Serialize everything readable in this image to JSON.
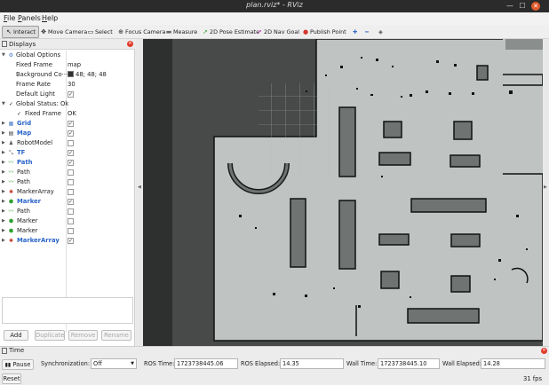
{
  "window": {
    "title": "plan.rviz* - RViz"
  },
  "menu": [
    {
      "label": "File",
      "mnemonic": "F",
      "rest": "ile"
    },
    {
      "label": "Panels",
      "mnemonic": "P",
      "rest": "anels"
    },
    {
      "label": "Help",
      "mnemonic": "H",
      "rest": "elp"
    }
  ],
  "toolbar": {
    "interact": "Interact",
    "move_camera": "Move Camera",
    "select": "Select",
    "focus_camera": "Focus Camera",
    "measure": "Measure",
    "pose_estimate": "2D Pose Estimate",
    "nav_goal": "2D Nav Goal",
    "publish_point": "Publish Point"
  },
  "displays": {
    "header": "Displays",
    "global_options": "Global Options",
    "fixed_frame_label": "Fixed Frame",
    "fixed_frame_value": "map",
    "background_label": "Background Co···",
    "background_value": "48; 48; 48",
    "background_color": "#303030",
    "frame_rate_label": "Frame Rate",
    "frame_rate_value": "30",
    "default_light_label": "Default Light",
    "global_status": "Global Status: Ok",
    "status_fixed_frame": "Fixed Frame",
    "status_fixed_frame_value": "OK",
    "items": [
      {
        "name": "Grid",
        "checked": true,
        "highlight": true,
        "icon": "grid-icon"
      },
      {
        "name": "Map",
        "checked": true,
        "highlight": true,
        "icon": "map-icon"
      },
      {
        "name": "RobotModel",
        "checked": false,
        "highlight": false,
        "icon": "robot-icon"
      },
      {
        "name": "TF",
        "checked": true,
        "highlight": true,
        "icon": "tf-icon"
      },
      {
        "name": "Path",
        "checked": true,
        "highlight": true,
        "icon": "path-icon"
      },
      {
        "name": "Path",
        "checked": false,
        "highlight": false,
        "icon": "path-icon"
      },
      {
        "name": "Path",
        "checked": false,
        "highlight": false,
        "icon": "path-icon"
      },
      {
        "name": "MarkerArray",
        "checked": false,
        "highlight": false,
        "icon": "marker-array-icon"
      },
      {
        "name": "Marker",
        "checked": true,
        "highlight": true,
        "icon": "marker-icon"
      },
      {
        "name": "Path",
        "checked": false,
        "highlight": false,
        "icon": "path-icon"
      },
      {
        "name": "Marker",
        "checked": false,
        "highlight": false,
        "icon": "marker-icon"
      },
      {
        "name": "Marker",
        "checked": false,
        "highlight": false,
        "icon": "marker-icon"
      },
      {
        "name": "MarkerArray",
        "checked": true,
        "highlight": true,
        "icon": "marker-array-icon"
      }
    ],
    "buttons": {
      "add": "Add",
      "duplicate": "Duplicate",
      "remove": "Remove",
      "rename": "Rename"
    }
  },
  "time": {
    "header": "Time",
    "pause": "Pause",
    "sync_label": "Synchronization:",
    "sync_value": "Off",
    "ros_time_label": "ROS Time:",
    "ros_time": "1723738445.06",
    "ros_elapsed_label": "ROS Elapsed:",
    "ros_elapsed": "14.35",
    "wall_time_label": "Wall Time:",
    "wall_time": "1723738445.10",
    "wall_elapsed_label": "Wall Elapsed:",
    "wall_elapsed": "14.28"
  },
  "status": {
    "reset": "Reset",
    "fps": "31 fps"
  }
}
